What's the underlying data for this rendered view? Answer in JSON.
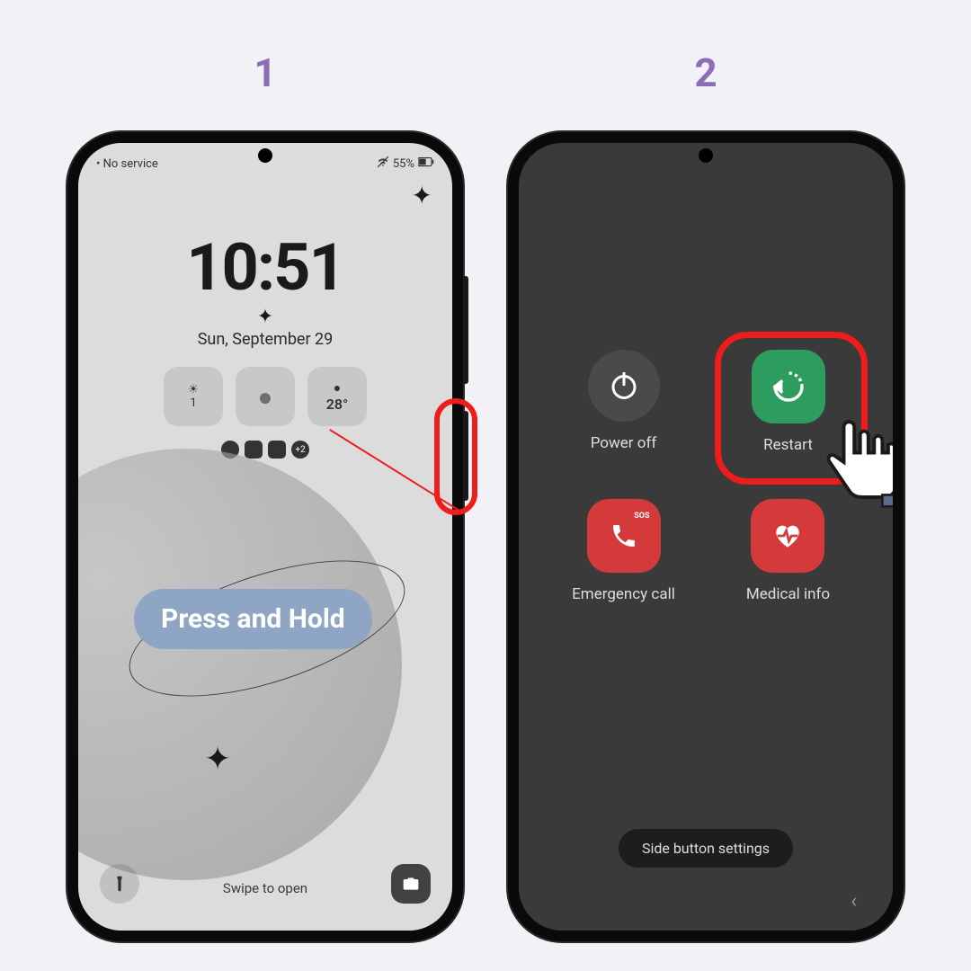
{
  "steps": {
    "one": "1",
    "two": "2"
  },
  "phone1": {
    "status_left": "• No service",
    "battery": "55%",
    "time": "10:51",
    "date": "Sun, September 29",
    "widget_count": "1",
    "widget_temp": "28°",
    "badge_count": "+2",
    "swipe": "Swipe to open",
    "annotation": "Press and Hold"
  },
  "phone2": {
    "power_off": "Power off",
    "restart": "Restart",
    "emergency": "Emergency call",
    "medical": "Medical info",
    "sos": "SOS",
    "side_settings": "Side button settings"
  }
}
